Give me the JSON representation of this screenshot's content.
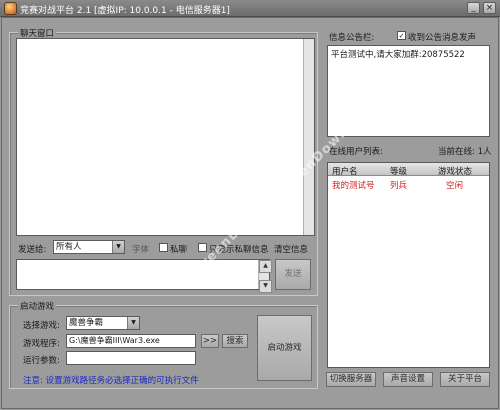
{
  "window": {
    "title": "竞赛对战平台 2.1 [虚拟IP: 10.0.0.1 - 电信服务器1]",
    "minimize": "_",
    "close": "×"
  },
  "chat": {
    "title": "聊天窗口",
    "send_to_label": "发送给:",
    "send_to_value": "所有人",
    "font_label": "字体",
    "private_label": "私聊",
    "private_only_label": "只显示私聊信息",
    "clear_label": "清空信息",
    "send_button": "发送"
  },
  "launch": {
    "title": "启动游戏",
    "select_game_label": "选择游戏:",
    "select_game_value": "魔兽争霸",
    "program_label": "游戏程序:",
    "program_value": "G:\\魔兽争霸III\\War3.exe",
    "browse_arrow": ">>",
    "search_button": "搜索",
    "params_label": "运行参数:",
    "params_value": "",
    "launch_button": "启动游戏",
    "notice": "注意: 设置游戏路径务必选择正确的可执行文件"
  },
  "notice_board": {
    "title": "信息公告栏:",
    "checkbox_label": "收到公告消息发声",
    "checkbox_checked": true,
    "text": "平台测试中,请大家加群:20875522"
  },
  "online": {
    "title": "在线用户列表:",
    "count_label": "当前在线: 1人",
    "columns": [
      "用户名",
      "等级",
      "游戏状态"
    ],
    "rows": [
      {
        "name": "我的测试号",
        "level": "列兵",
        "status": "空闲"
      }
    ]
  },
  "bottom_buttons": {
    "switch_server": "切换服务器",
    "sound_settings": "声音设置",
    "about": "关于平台"
  },
  "colors": {
    "background": "#9c9c9c",
    "user_row": "#d42020",
    "notice_text": "#1a2ac0"
  },
  "watermark": "GreenDown.cn"
}
